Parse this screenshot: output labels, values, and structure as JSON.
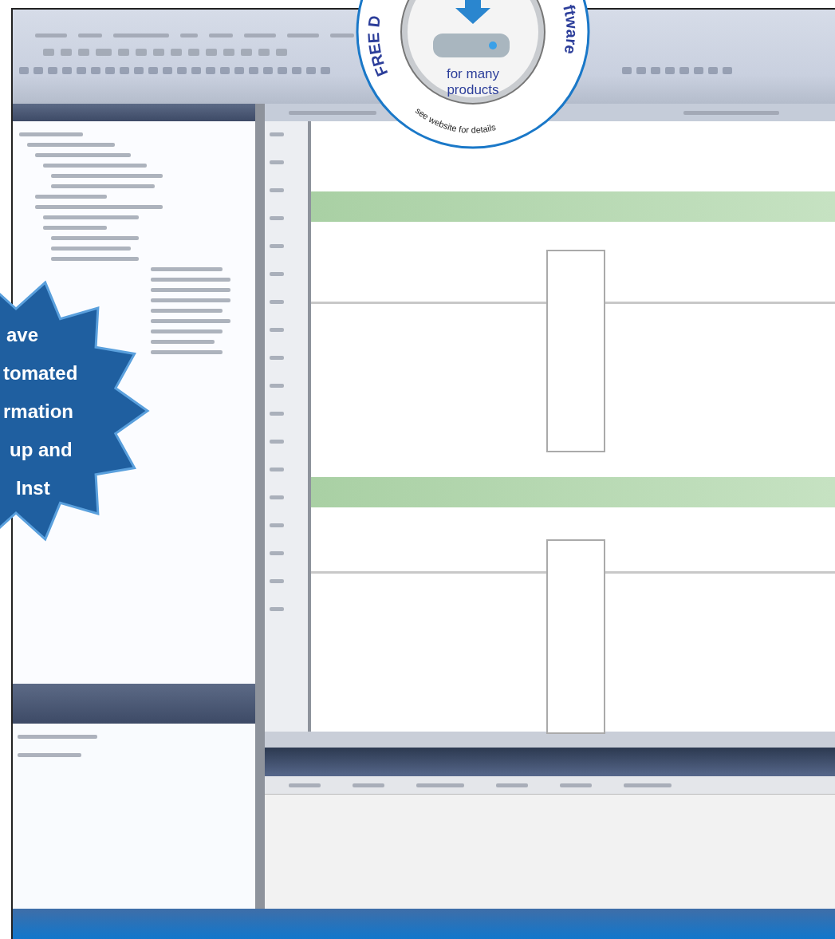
{
  "download_badge": {
    "arc_left": "FREE D",
    "arc_right": "ftware",
    "lines": [
      "for many",
      "products"
    ],
    "footer": "see website for details"
  },
  "starburst": {
    "lines": [
      "ave",
      "tomated",
      "rmation",
      "up and",
      "Inst"
    ]
  }
}
